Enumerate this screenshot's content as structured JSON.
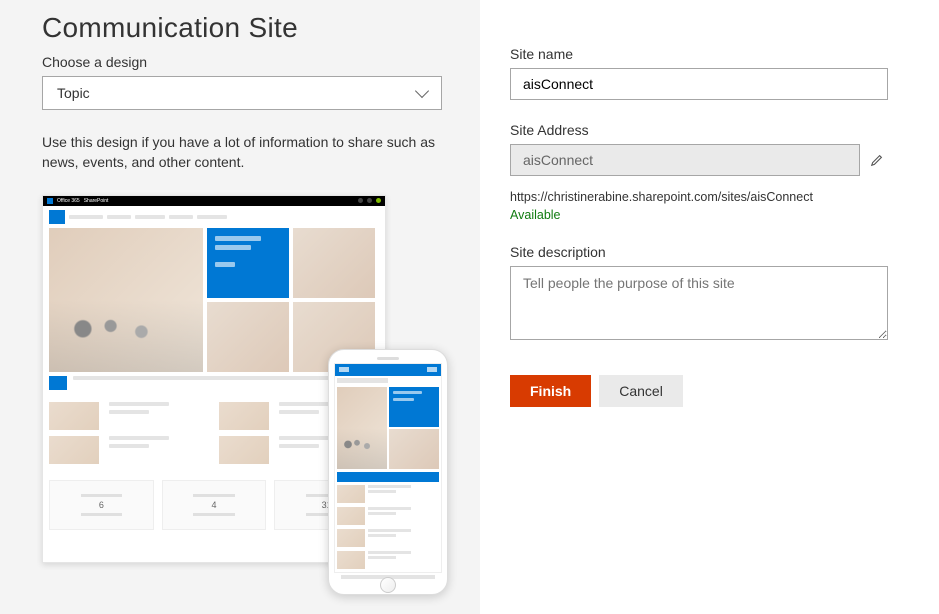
{
  "page_title": "Communication Site",
  "design_label": "Choose a design",
  "design_selected": "Topic",
  "design_description": "Use this design if you have a lot of information to share such as news, events, and other content.",
  "preview": {
    "suite": "Office 365",
    "app": "SharePoint",
    "calendar_dates": [
      "6",
      "4",
      "31"
    ]
  },
  "form": {
    "site_name_label": "Site name",
    "site_name_value": "aisConnect",
    "site_address_label": "Site Address",
    "site_address_value": "aisConnect",
    "full_url": "https://christinerabine.sharepoint.com/sites/aisConnect",
    "availability": "Available",
    "description_label": "Site description",
    "description_placeholder": "Tell people the purpose of this site",
    "description_value": "",
    "btn_finish": "Finish",
    "btn_cancel": "Cancel"
  }
}
